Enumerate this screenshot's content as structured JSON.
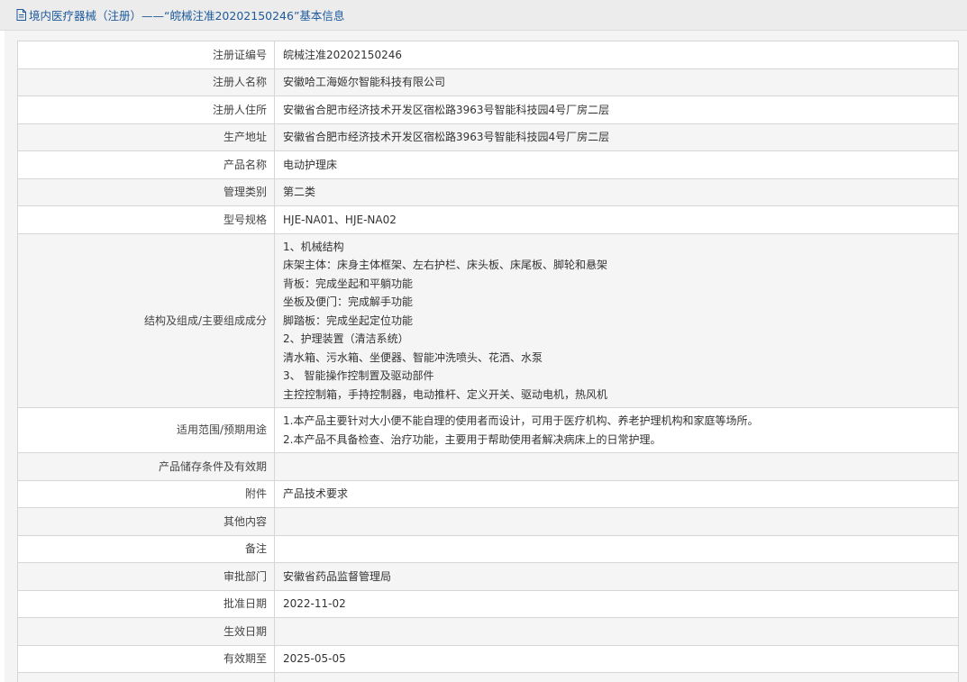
{
  "header": {
    "title": "境内医疗器械（注册）——“皖械注准20202150246”基本信息",
    "icon": "document-icon"
  },
  "rows": [
    {
      "label": "注册证编号",
      "value": "皖械注准20202150246"
    },
    {
      "label": "注册人名称",
      "value": "安徽哈工海姬尔智能科技有限公司"
    },
    {
      "label": "注册人住所",
      "value": "安徽省合肥市经济技术开发区宿松路3963号智能科技园4号厂房二层"
    },
    {
      "label": "生产地址",
      "value": "安徽省合肥市经济技术开发区宿松路3963号智能科技园4号厂房二层"
    },
    {
      "label": "产品名称",
      "value": "电动护理床"
    },
    {
      "label": "管理类别",
      "value": "第二类"
    },
    {
      "label": "型号规格",
      "value": "HJE-NA01、HJE-NA02"
    },
    {
      "label": "结构及组成/主要组成成分",
      "lines": [
        "1、机械结构",
        "床架主体：床身主体框架、左右护栏、床头板、床尾板、脚轮和悬架",
        "背板：完成坐起和平躺功能",
        "坐板及便门：完成解手功能",
        "脚踏板：完成坐起定位功能",
        "2、护理装置（清洁系统）",
        "清水箱、污水箱、坐便器、智能冲洗喷头、花洒、水泵",
        "3、 智能操作控制置及驱动部件",
        "主控控制箱，手持控制器，电动推杆、定义开关、驱动电机，热风机"
      ]
    },
    {
      "label": "适用范围/预期用途",
      "lines": [
        "1.本产品主要针对大小便不能自理的使用者而设计，可用于医疗机构、养老护理机构和家庭等场所。",
        "2.本产品不具备检查、治疗功能，主要用于帮助使用者解决病床上的日常护理。"
      ]
    },
    {
      "label": "产品储存条件及有效期",
      "value": ""
    },
    {
      "label": "附件",
      "value": "产品技术要求"
    },
    {
      "label": "其他内容",
      "value": ""
    },
    {
      "label": "备注",
      "value": ""
    },
    {
      "label": "审批部门",
      "value": "安徽省药品监督管理局"
    },
    {
      "label": "批准日期",
      "value": "2022-11-02"
    },
    {
      "label": "生效日期",
      "value": ""
    },
    {
      "label": "有效期至",
      "value": "2025-05-05"
    },
    {
      "label": "",
      "value": ""
    }
  ]
}
